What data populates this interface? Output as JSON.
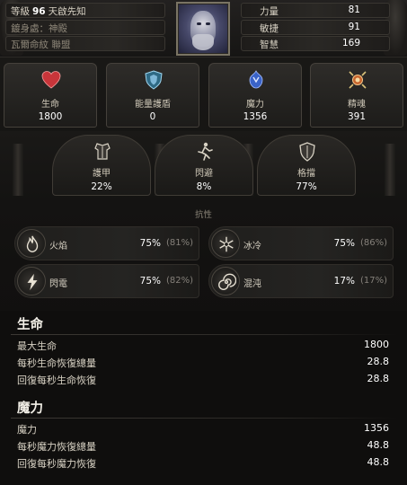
{
  "header": {
    "level_label": "等級",
    "level_value": "96",
    "class_name": "天啟先知",
    "guardian": "鍍身處：神殿",
    "alliance": "瓦爾命紋 聯盟"
  },
  "attributes": [
    {
      "label": "力量",
      "value": "81"
    },
    {
      "label": "敏捷",
      "value": "91"
    },
    {
      "label": "智慧",
      "value": "169"
    }
  ],
  "top_stats": [
    {
      "label": "生命",
      "value": "1800",
      "icon": "heart-icon"
    },
    {
      "label": "能量護盾",
      "value": "0",
      "icon": "energy-shield-icon"
    },
    {
      "label": "魔力",
      "value": "1356",
      "icon": "mana-icon"
    },
    {
      "label": "精魂",
      "value": "391",
      "icon": "spirit-icon"
    }
  ],
  "defenses": [
    {
      "label": "護甲",
      "value": "22%",
      "icon": "armour-icon"
    },
    {
      "label": "閃避",
      "value": "8%",
      "icon": "evasion-icon"
    },
    {
      "label": "格擋",
      "value": "77%",
      "icon": "block-icon"
    }
  ],
  "resistance": {
    "title": "抗性",
    "items": [
      {
        "label": "火焰",
        "value": "75%",
        "max": "(81%)",
        "icon": "fire-icon"
      },
      {
        "label": "冰冷",
        "value": "75%",
        "max": "(86%)",
        "icon": "cold-icon"
      },
      {
        "label": "閃電",
        "value": "75%",
        "max": "(82%)",
        "icon": "lightning-icon"
      },
      {
        "label": "混沌",
        "value": "17%",
        "max": "(17%)",
        "icon": "chaos-icon"
      }
    ]
  },
  "life_section": {
    "title": "生命",
    "rows": [
      {
        "label": "最大生命",
        "value": "1800"
      },
      {
        "label": "每秒生命恢復總量",
        "value": "28.8"
      },
      {
        "label": "回復每秒生命恢復",
        "value": "28.8"
      }
    ]
  },
  "mana_section": {
    "title": "魔力",
    "rows": [
      {
        "label": "魔力",
        "value": "1356"
      },
      {
        "label": "每秒魔力恢復總量",
        "value": "48.8"
      },
      {
        "label": "回復每秒魔力恢復",
        "value": "48.8"
      }
    ]
  },
  "colors": {
    "life": "#c8353a",
    "mana": "#3a63c8",
    "spirit": "#d9c27a",
    "shield": "#7fb8d8"
  }
}
